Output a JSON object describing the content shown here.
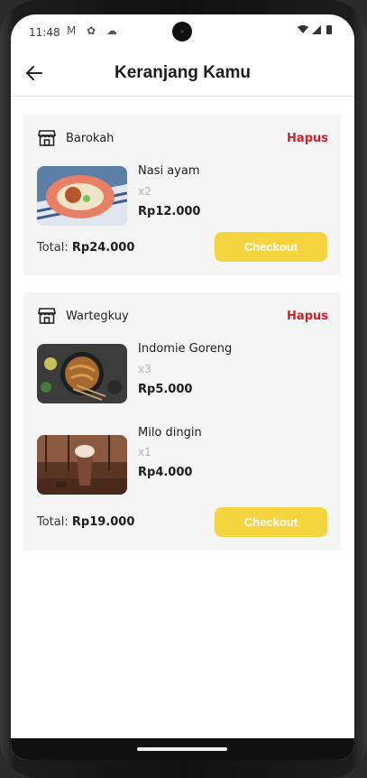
{
  "status": {
    "time": "11:48",
    "left_icons": "M ✿ ☁",
    "right_icons": "▾◢▮"
  },
  "appbar": {
    "title": "Keranjang Kamu",
    "back_icon": "arrow-left-icon"
  },
  "stores": [
    {
      "name": "Barokah",
      "delete_label": "Hapus",
      "items": [
        {
          "name": "Nasi ayam",
          "qty": "x2",
          "price": "Rp12.000"
        }
      ],
      "total_label": "Total:",
      "total_value": "Rp24.000",
      "checkout_label": "Checkout"
    },
    {
      "name": "Wartegkuy",
      "delete_label": "Hapus",
      "items": [
        {
          "name": "Indomie Goreng",
          "qty": "x3",
          "price": "Rp5.000"
        },
        {
          "name": "Milo dingin",
          "qty": "x1",
          "price": "Rp4.000"
        }
      ],
      "total_label": "Total:",
      "total_value": "Rp19.000",
      "checkout_label": "Checkout"
    }
  ],
  "colors": {
    "accent": "#f5d53f",
    "danger": "#d0202a",
    "card_bg": "#f4f5f4"
  }
}
